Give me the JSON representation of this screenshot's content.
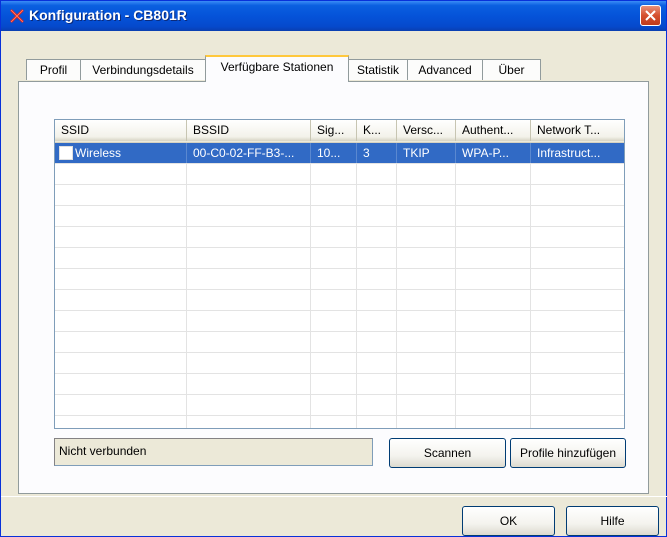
{
  "window": {
    "title": "Konfiguration - CB801R",
    "icon": "red-x-icon",
    "colors": {
      "titlebar": "#0553d9",
      "selection": "#316ac5",
      "tab_highlight": "#ffc83c"
    }
  },
  "tabs": [
    {
      "label": "Profil"
    },
    {
      "label": "Verbindungsdetails"
    },
    {
      "label": "Verfügbare Stationen",
      "active": true
    },
    {
      "label": "Statistik"
    },
    {
      "label": "Advanced"
    },
    {
      "label": "Über"
    }
  ],
  "stations": {
    "columns": [
      "SSID",
      "BSSID",
      "Sig...",
      "K...",
      "Versc...",
      "Authent...",
      "Network T..."
    ],
    "rows": [
      [
        "Wireless",
        "00-C0-02-FF-B3-...",
        "10...",
        "3",
        "TKIP",
        "WPA-P...",
        "Infrastruct..."
      ]
    ]
  },
  "status": {
    "text": "Nicht verbunden"
  },
  "buttons": {
    "scan": "Scannen",
    "add_profile": "Profile hinzufügen",
    "ok": "OK",
    "help": "Hilfe"
  }
}
